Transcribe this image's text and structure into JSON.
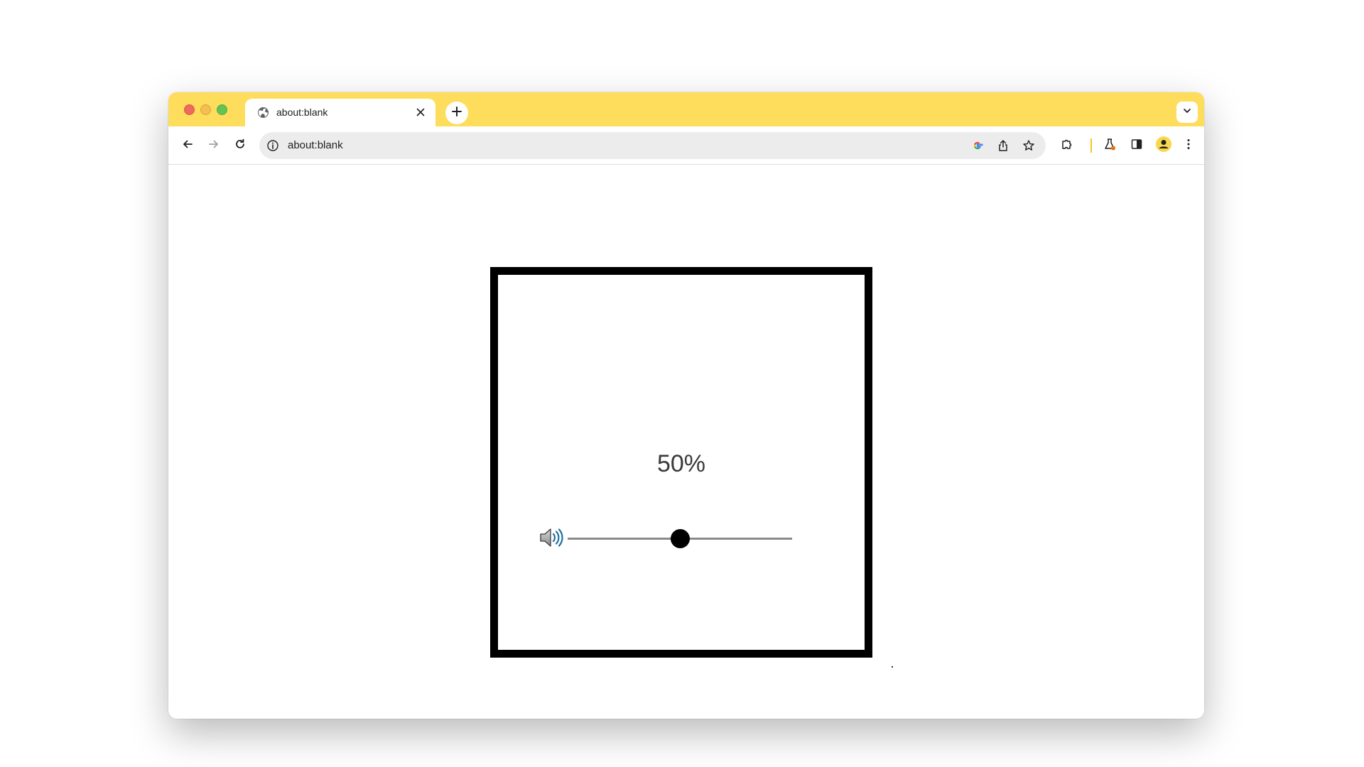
{
  "browser": {
    "tab": {
      "title": "about:blank",
      "favicon": "globe-icon"
    },
    "new_tab_icon": "plus-icon",
    "tab_search_icon": "chevron-down-icon",
    "address_bar": {
      "url": "about:blank",
      "security_icon": "info-icon"
    },
    "colors": {
      "frame": "#FEDD5C",
      "omnibox": "#ECECEC"
    }
  },
  "player": {
    "volume_text": "50%",
    "volume_level": 0.5,
    "icon": "speaker-icon",
    "colors": {
      "border": "#000000",
      "thumb": "#000000",
      "track": "#8a8a8a"
    }
  }
}
